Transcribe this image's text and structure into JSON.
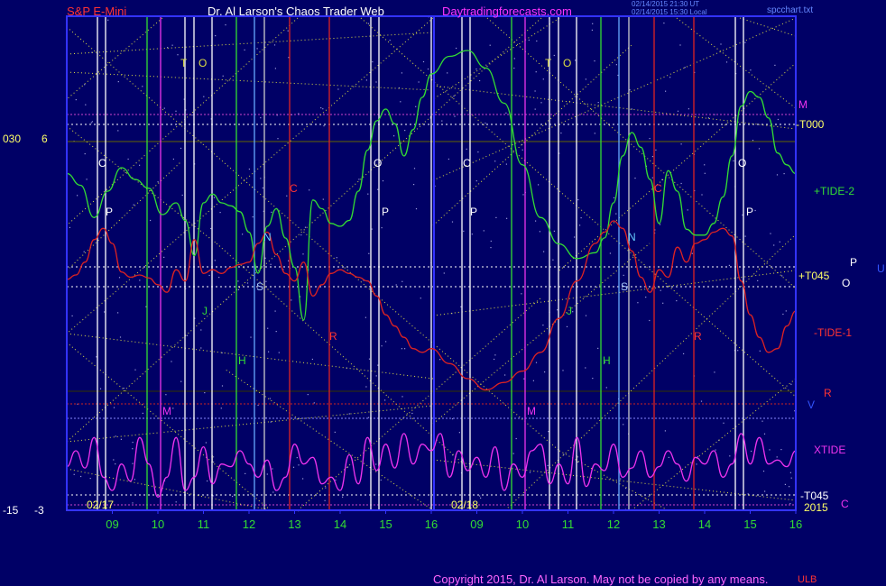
{
  "header": {
    "symbol": "S&P E-Mini",
    "author": "Dr. Al Larson's Chaos Trader Web",
    "site": "Daytradingforecasts.com",
    "stamp_line1": "02/14/2015 21:30 UT",
    "stamp_line2": "02/14/2015 15:30 Local",
    "file": "spcchart.txt"
  },
  "left_scale": {
    "top_left": "030",
    "top_right": "6",
    "bottom_left": "-15",
    "bottom_right": "-3"
  },
  "right_labels": {
    "m": "M",
    "t000": "-T000",
    "tide2": "+TIDE-2",
    "t045": "+T045",
    "p": "P",
    "u": "U",
    "o": "O",
    "tide1": "-TIDE-1",
    "r": "R",
    "v": "V",
    "xtide": "XTIDE",
    "t045neg": "-T045",
    "year": "2015",
    "c": "C"
  },
  "copyright": "Copyright 2015, Dr. Al Larson. May not be copied by any means.",
  "footer_tag": "ULB",
  "colors": {
    "background": "#000066",
    "frame": "#3333ff",
    "tide2": "#33dd33",
    "tide1": "#dd2222",
    "xtide": "#ee33ee",
    "grid": "#dddd44",
    "hour_label": "#33dd33"
  },
  "chart_data": {
    "type": "line",
    "days": [
      {
        "date": "02/17",
        "hours": [
          "09",
          "10",
          "11",
          "12",
          "13",
          "14",
          "15",
          "16"
        ],
        "markers": [
          {
            "text": "T",
            "color": "#dddd44"
          },
          {
            "text": "O",
            "color": "#dddd44"
          },
          {
            "text": "C",
            "color": "#ffffff"
          },
          {
            "text": "P",
            "color": "#ffffff"
          },
          {
            "text": "J",
            "color": "#33dd33"
          },
          {
            "text": "S",
            "color": "#aaccff"
          },
          {
            "text": "N",
            "color": "#66ccff"
          },
          {
            "text": "C",
            "color": "#ff3333"
          },
          {
            "text": "H",
            "color": "#33dd33"
          },
          {
            "text": "R",
            "color": "#ff3333"
          },
          {
            "text": "M",
            "color": "#ee33ee"
          },
          {
            "text": "t",
            "color": "#cccccc"
          },
          {
            "text": "O",
            "color": "#ffffff"
          },
          {
            "text": "P",
            "color": "#ffffff"
          }
        ]
      },
      {
        "date": "02/18",
        "hours": [
          "09",
          "10",
          "11",
          "12",
          "13",
          "14",
          "15",
          "16"
        ],
        "markers": [
          {
            "text": "T",
            "color": "#dddd44"
          },
          {
            "text": "O",
            "color": "#dddd44"
          },
          {
            "text": "C",
            "color": "#ffffff"
          },
          {
            "text": "P",
            "color": "#ffffff"
          },
          {
            "text": "J",
            "color": "#33dd33"
          },
          {
            "text": "S",
            "color": "#aaccff"
          },
          {
            "text": "N",
            "color": "#66ccff"
          },
          {
            "text": "C",
            "color": "#ff3333"
          },
          {
            "text": "H",
            "color": "#33dd33"
          },
          {
            "text": "R",
            "color": "#ff3333"
          },
          {
            "text": "M",
            "color": "#ee33ee"
          },
          {
            "text": "t",
            "color": "#cccccc"
          },
          {
            "text": "O",
            "color": "#ffffff"
          },
          {
            "text": "P",
            "color": "#ffffff"
          }
        ]
      }
    ],
    "series": [
      {
        "name": "+TIDE-2",
        "color": "#33dd33",
        "x": [
          8.0,
          8.3,
          8.6,
          8.9,
          9.2,
          9.5,
          9.8,
          10.1,
          10.4,
          10.6,
          10.8,
          11.0,
          11.2,
          11.4,
          11.6,
          11.8,
          12.0,
          12.2,
          12.4,
          12.6,
          12.8,
          13.0,
          13.2,
          13.4,
          13.6,
          13.8,
          14.0,
          14.2,
          14.4,
          14.6,
          14.8,
          15.0,
          15.2,
          15.4,
          15.6,
          15.8,
          16.0,
          16.4,
          16.8,
          17.2,
          17.6,
          18.0,
          18.4,
          18.8,
          19.2,
          19.6,
          19.8,
          20.0,
          20.2,
          20.4,
          20.6,
          20.8,
          21.0,
          21.2,
          21.4,
          21.6,
          21.8,
          22.0,
          22.2,
          22.4,
          22.6,
          22.8,
          23.0,
          23.2,
          23.4,
          23.6,
          23.8,
          24.0
        ],
        "values": [
          4.0,
          3.6,
          2.5,
          3.4,
          4.2,
          3.8,
          3.5,
          2.6,
          3.0,
          2.4,
          1.2,
          3.0,
          3.3,
          3.0,
          2.9,
          2.7,
          2.0,
          0.6,
          2.2,
          2.8,
          1.8,
          0.8,
          -1.0,
          3.1,
          2.8,
          2.3,
          2.2,
          2.4,
          3.4,
          4.8,
          5.8,
          6.2,
          5.7,
          4.6,
          5.5,
          6.6,
          7.4,
          8.0,
          8.2,
          7.6,
          6.4,
          4.3,
          2.5,
          1.6,
          1.1,
          1.3,
          1.8,
          3.0,
          4.6,
          5.4,
          4.9,
          3.8,
          2.3,
          4.1,
          3.4,
          2.1,
          1.9,
          1.9,
          2.3,
          3.2,
          4.6,
          6.3,
          6.8,
          6.6,
          5.9,
          4.7,
          4.3,
          4.0
        ],
        "bounds": [
          -3,
          9
        ]
      },
      {
        "name": "-TIDE-1",
        "color": "#dd2222",
        "x": [
          8.0,
          8.2,
          8.4,
          8.6,
          8.8,
          9.0,
          9.2,
          9.4,
          9.6,
          9.8,
          10.0,
          10.2,
          10.4,
          10.6,
          10.8,
          11.0,
          11.2,
          11.4,
          11.6,
          11.8,
          12.0,
          12.2,
          12.4,
          12.6,
          12.8,
          13.0,
          13.2,
          13.4,
          13.6,
          13.8,
          14.0,
          14.2,
          14.4,
          14.6,
          14.8,
          15.0,
          15.2,
          15.4,
          15.6,
          15.8,
          16.0,
          16.4,
          16.8,
          17.2,
          17.6,
          18.0,
          18.4,
          18.8,
          19.2,
          19.6,
          19.8,
          20.0,
          20.2,
          20.4,
          20.6,
          20.8,
          21.0,
          21.2,
          21.4,
          21.6,
          21.8,
          22.0,
          22.2,
          22.4,
          22.6,
          22.8,
          23.0,
          23.2,
          23.4,
          23.6,
          23.8,
          24.0
        ],
        "values": [
          -2.8,
          -2.2,
          -0.5,
          2.5,
          4.0,
          2.0,
          -1.8,
          -2.5,
          -2.2,
          -2.6,
          -3.5,
          -4.5,
          -1.5,
          -3.0,
          2.5,
          -2.0,
          -1.5,
          -2.0,
          -1.2,
          -0.8,
          -0.5,
          2.0,
          3.5,
          0.5,
          -2.0,
          -3.0,
          -0.5,
          -5.0,
          -3.5,
          -2.0,
          -1.5,
          -2.0,
          -2.5,
          -3.0,
          -5.0,
          -7.5,
          -9.0,
          -10.5,
          -12.0,
          -12.5,
          -12.0,
          -14.0,
          -16.0,
          -17.5,
          -16.5,
          -15.0,
          -12.5,
          -8.0,
          -3.0,
          2.0,
          3.5,
          5.0,
          4.0,
          1.0,
          -2.5,
          -4.5,
          -1.5,
          -2.5,
          1.5,
          -0.5,
          2.0,
          2.5,
          3.5,
          4.0,
          3.0,
          -3.0,
          -7.5,
          -10.5,
          -12.5,
          -12.0,
          -9.0,
          -7.0
        ],
        "bounds": [
          -22,
          8
        ]
      },
      {
        "name": "XTIDE",
        "color": "#ee33ee",
        "x": [
          8.0,
          8.2,
          8.4,
          8.6,
          8.8,
          9.0,
          9.2,
          9.4,
          9.6,
          9.8,
          10.0,
          10.2,
          10.4,
          10.6,
          10.8,
          11.0,
          11.2,
          11.4,
          11.6,
          11.8,
          12.0,
          12.2,
          12.4,
          12.6,
          12.8,
          13.0,
          13.2,
          13.4,
          13.6,
          13.8,
          14.0,
          14.2,
          14.4,
          14.6,
          14.8,
          15.0,
          15.2,
          15.4,
          15.6,
          15.8,
          16.0,
          16.2,
          16.4,
          16.6,
          16.8,
          17.0,
          17.2,
          17.4,
          17.6,
          17.8,
          18.0,
          18.2,
          18.4,
          18.6,
          18.8,
          19.0,
          19.2,
          19.4,
          19.6,
          19.8,
          20.0,
          20.2,
          20.4,
          20.6,
          20.8,
          21.0,
          21.2,
          21.4,
          21.6,
          21.8,
          22.0,
          22.2,
          22.4,
          22.6,
          22.8,
          23.0,
          23.2,
          23.4,
          23.6,
          23.8,
          24.0
        ],
        "values": [
          0.3,
          1.5,
          0.2,
          2.5,
          -0.5,
          -1.5,
          0.5,
          -0.8,
          2.5,
          0.5,
          -2.0,
          -0.5,
          2.5,
          -1.5,
          -0.5,
          1.8,
          -1.0,
          0.5,
          0.3,
          1.5,
          0.5,
          -0.5,
          0.8,
          -1.5,
          -0.5,
          2.0,
          0.5,
          1.0,
          -1.0,
          -0.5,
          -1.5,
          1.2,
          -1.0,
          2.5,
          0.0,
          2.0,
          0.2,
          2.8,
          0.5,
          2.0,
          1.5,
          2.8,
          -0.5,
          1.5,
          0.0,
          1.0,
          -0.5,
          1.8,
          -1.5,
          0.5,
          -0.5,
          1.5,
          2.0,
          -1.0,
          0.5,
          -1.0,
          2.5,
          -1.2,
          0.5,
          0.0,
          2.0,
          -0.5,
          0.2,
          1.5,
          -0.5,
          0.3,
          1.5,
          0.5,
          -0.8,
          1.0,
          0.5,
          1.5,
          -0.5,
          0.5,
          2.8,
          0.5,
          2.5,
          0.5,
          0.8,
          0.3,
          1.5
        ],
        "bounds": [
          -3,
          3
        ]
      }
    ],
    "xlim": [
      8,
      24
    ]
  }
}
